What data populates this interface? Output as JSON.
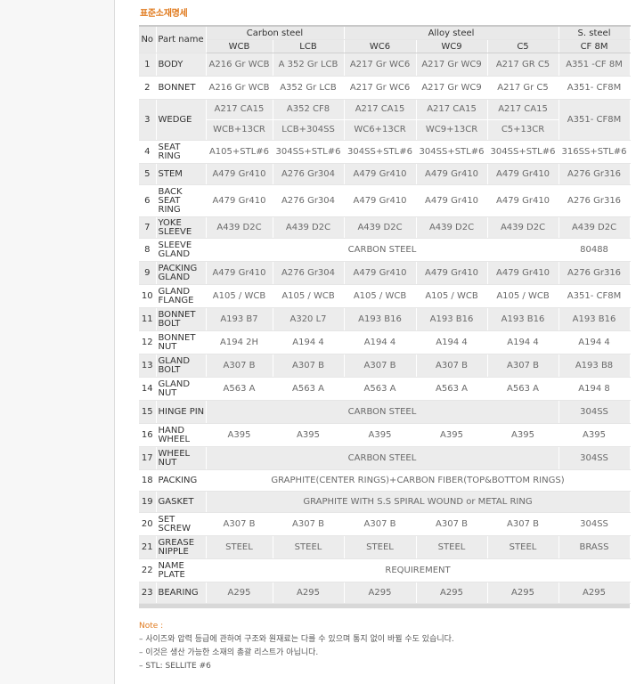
{
  "title": "표준소재명세",
  "headers": {
    "no": "No",
    "part": "Part name",
    "groups": [
      "Carbon steel",
      "Alloy steel",
      "S. steel"
    ],
    "subs": [
      "WCB",
      "LCB",
      "WC6",
      "WC9",
      "C5",
      "CF 8M"
    ]
  },
  "rows": [
    {
      "no": "1",
      "part": "BODY",
      "cells": [
        "A216 Gr WCB",
        "A 352 Gr LCB",
        "A217 Gr  WC6",
        "A217 Gr WC9",
        "A217 GR C5",
        "A351 -CF 8M"
      ]
    },
    {
      "no": "2",
      "part": "BONNET",
      "cells": [
        "A216 Gr WCB",
        "A352 Gr LCB",
        "A217 Gr WC6",
        "A217 Gr WC9",
        "A217 Gr C5",
        "A351- CF8M"
      ]
    },
    {
      "no": "3",
      "part": "WEDGE",
      "top": [
        "A217 CA15",
        "A352 CF8",
        "A217 CA15",
        "A217 CA15",
        "A217 CA15"
      ],
      "bottom": [
        "WCB+13CR",
        "LCB+304SS",
        "WC6+13CR",
        "WC9+13CR",
        "C5+13CR"
      ],
      "last": "A351- CF8M"
    },
    {
      "no": "4",
      "part": "SEAT RING",
      "cells": [
        "A105+STL#6",
        "304SS+STL#6",
        "304SS+STL#6",
        "304SS+STL#6",
        "304SS+STL#6",
        "316SS+STL#6"
      ]
    },
    {
      "no": "5",
      "part": "STEM",
      "cells": [
        "A479 Gr410",
        "A276 Gr304",
        "A479 Gr410",
        "A479 Gr410",
        "A479 Gr410",
        "A276 Gr316"
      ]
    },
    {
      "no": "6",
      "part": "BACK SEAT RING",
      "cells": [
        "A479 Gr410",
        "A276 Gr304",
        "A479 Gr410",
        "A479 Gr410",
        "A479 Gr410",
        "A276 Gr316"
      ]
    },
    {
      "no": "7",
      "part": "YOKE SLEEVE",
      "cells": [
        "A439 D2C",
        "A439 D2C",
        "A439 D2C",
        "A439 D2C",
        "A439 D2C",
        "A439 D2C"
      ]
    },
    {
      "no": "8",
      "part": "SLEEVE GLAND",
      "span": "CARBON STEEL",
      "last": "80488"
    },
    {
      "no": "9",
      "part": "PACKING GLAND",
      "cells": [
        "A479 Gr410",
        "A276 Gr304",
        "A479 Gr410",
        "A479 Gr410",
        "A479 Gr410",
        "A276 Gr316"
      ]
    },
    {
      "no": "10",
      "part": "GLAND FLANGE",
      "cells": [
        "A105 / WCB",
        "A105 / WCB",
        "A105 / WCB",
        "A105 / WCB",
        "A105 / WCB",
        "A351- CF8M"
      ]
    },
    {
      "no": "11",
      "part": "BONNET BOLT",
      "cells": [
        "A193 B7",
        "A320 L7",
        "A193 B16",
        "A193 B16",
        "A193 B16",
        "A193 B16"
      ]
    },
    {
      "no": "12",
      "part": "BONNET NUT",
      "cells": [
        "A194 2H",
        "A194 4",
        "A194 4",
        "A194 4",
        "A194 4",
        "A194 4"
      ]
    },
    {
      "no": "13",
      "part": "GLAND BOLT",
      "cells": [
        "A307 B",
        "A307 B",
        "A307 B",
        "A307 B",
        "A307 B",
        "A193 B8"
      ]
    },
    {
      "no": "14",
      "part": "GLAND NUT",
      "cells": [
        "A563 A",
        "A563 A",
        "A563 A",
        "A563 A",
        "A563 A",
        "A194 8"
      ]
    },
    {
      "no": "15",
      "part": "HINGE PIN",
      "span": "CARBON STEEL",
      "last": "304SS"
    },
    {
      "no": "16",
      "part": "HAND WHEEL",
      "cells": [
        "A395",
        "A395",
        "A395",
        "A395",
        "A395",
        "A395"
      ]
    },
    {
      "no": "17",
      "part": "WHEEL NUT",
      "span": "CARBON STEEL",
      "last": "304SS"
    },
    {
      "no": "18",
      "part": "PACKING",
      "full": "GRAPHITE(CENTER RINGS)+CARBON FIBER(TOP&BOTTOM RINGS)"
    },
    {
      "no": "19",
      "part": "GASKET",
      "full": "GRAPHITE WITH S.S SPIRAL WOUND or METAL RING"
    },
    {
      "no": "20",
      "part": "SET SCREW",
      "cells": [
        "A307 B",
        "A307 B",
        "A307 B",
        "A307 B",
        "A307 B",
        "304SS"
      ]
    },
    {
      "no": "21",
      "part": "GREASE NIPPLE",
      "cells": [
        "STEEL",
        "STEEL",
        "STEEL",
        "STEEL",
        "STEEL",
        "BRASS"
      ]
    },
    {
      "no": "22",
      "part": "NAME PLATE",
      "full": "REQUIREMENT"
    },
    {
      "no": "23",
      "part": "BEARING",
      "cells": [
        "A295",
        "A295",
        "A295",
        "A295",
        "A295",
        "A295"
      ]
    }
  ],
  "notes": {
    "heading": "Note :",
    "lines": [
      "– 사이즈와 압력 등급에 관하여 구조와 원재료는 다를 수 있으며 통지 없이 바뀔 수도 있습니다.",
      "– 이것은 생산 가능한 소재의 총괄 리스트가 아닙니다.",
      "– STL: SELLITE #6"
    ]
  }
}
